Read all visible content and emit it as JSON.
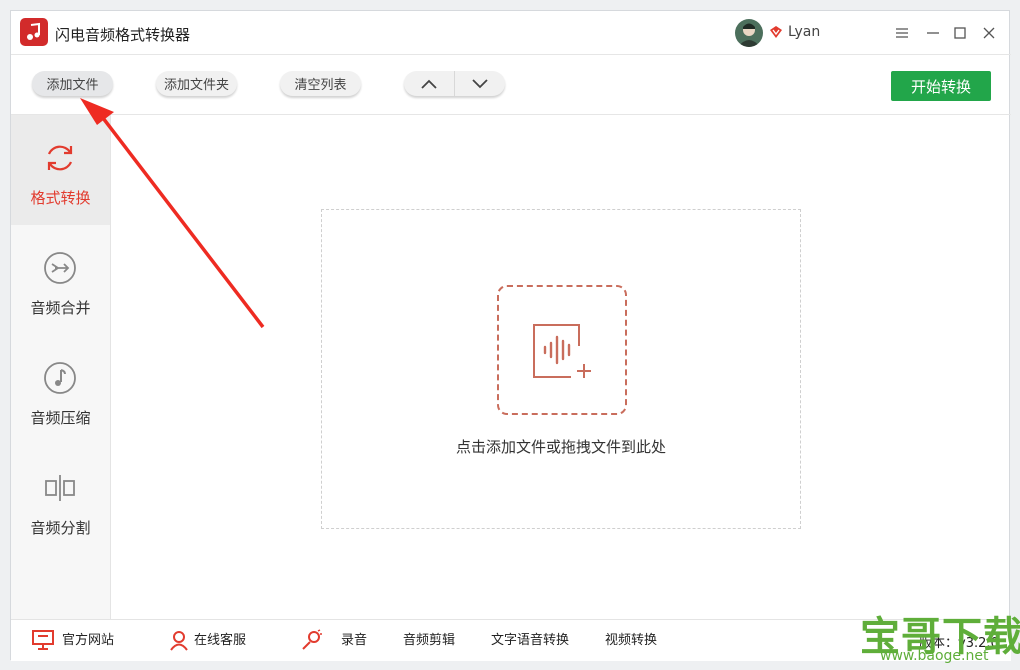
{
  "app": {
    "title": "闪电音频格式转换器"
  },
  "user": {
    "name": "Lyan"
  },
  "toolbar": {
    "add_file": "添加文件",
    "add_folder": "添加文件夹",
    "clear_list": "清空列表",
    "start_convert": "开始转换"
  },
  "sidebar": {
    "items": [
      {
        "label": "格式转换",
        "icon": "refresh-icon",
        "active": true
      },
      {
        "label": "音频合并",
        "icon": "merge-icon",
        "active": false
      },
      {
        "label": "音频压缩",
        "icon": "music-note-icon",
        "active": false
      },
      {
        "label": "音频分割",
        "icon": "split-icon",
        "active": false
      }
    ]
  },
  "main": {
    "drop_hint": "点击添加文件或拖拽文件到此处"
  },
  "bottom": {
    "website": "官方网站",
    "support": "在线客服",
    "record": "录音",
    "audio_edit": "音频剪辑",
    "tts": "文字语音转换",
    "video_convert": "视频转换",
    "version": "版本：v3.2.0"
  },
  "watermark": {
    "title": "宝哥下载",
    "url": "www.baoge.net"
  },
  "colors": {
    "accent": "#e23b2e",
    "start_button": "#22a64a",
    "drop_icon": "#c96d5c"
  }
}
